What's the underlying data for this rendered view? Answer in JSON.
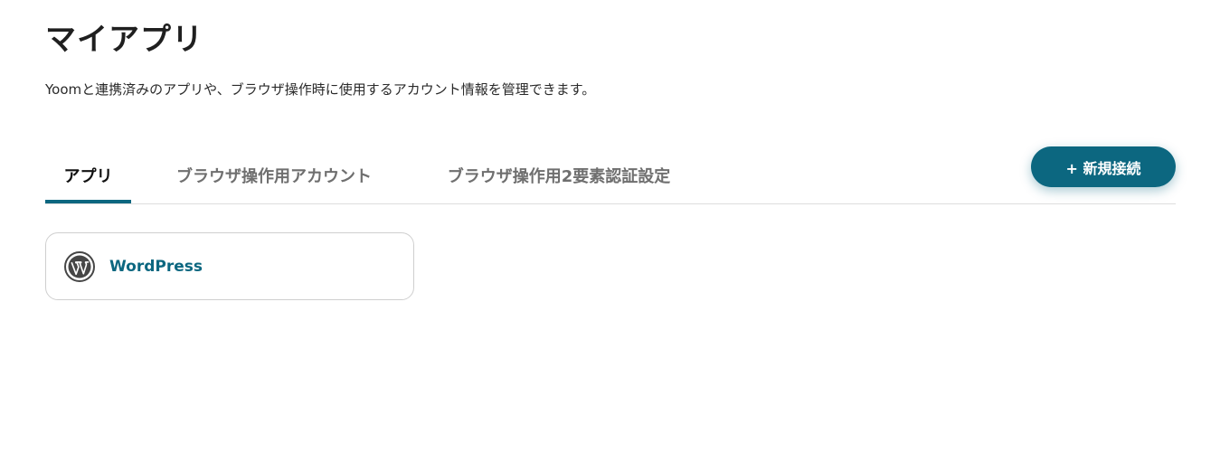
{
  "header": {
    "title": "マイアプリ",
    "description": "Yoomと連携済みのアプリや、ブラウザ操作時に使用するアカウント情報を管理できます。"
  },
  "tabs": [
    {
      "label": "アプリ",
      "active": true
    },
    {
      "label": "ブラウザ操作用アカウント",
      "active": false
    },
    {
      "label": "ブラウザ操作用2要素認証設定",
      "active": false
    }
  ],
  "actions": {
    "new_connection_label": "+ 新規接続"
  },
  "apps": [
    {
      "name": "WordPress",
      "icon": "wordpress-icon"
    }
  ],
  "colors": {
    "accent": "#0c6780",
    "border": "#cfcfcf",
    "tab_inactive": "#6f6f6f"
  }
}
